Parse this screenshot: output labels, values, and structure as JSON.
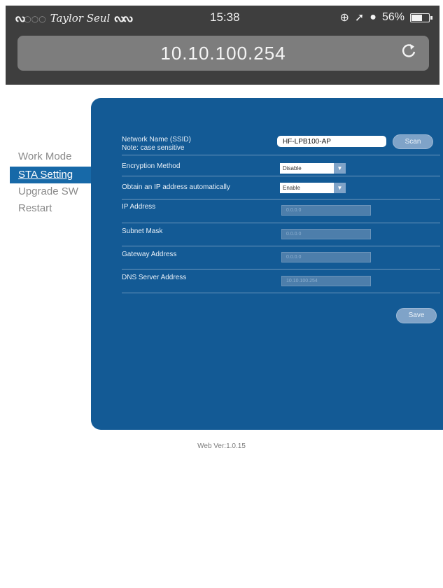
{
  "status_bar": {
    "carrier": "Taylor Seul",
    "time": "15:38",
    "battery_percent_label": "56%",
    "battery_level": 0.56,
    "icons": [
      "wifi-icon",
      "orientation-lock-icon",
      "location-arrow-icon",
      "alarm-icon",
      "battery-icon"
    ]
  },
  "browser": {
    "url": "10.10.100.254",
    "reload_glyph": "C"
  },
  "menu": {
    "items": [
      {
        "label": "Work Mode",
        "active": false
      },
      {
        "label": "STA Setting",
        "active": true
      },
      {
        "label": "Upgrade SW",
        "active": false
      },
      {
        "label": "Restart",
        "active": false
      }
    ]
  },
  "form": {
    "ssid": {
      "label_line1": "Network Name (SSID)",
      "label_line2": "Note: case sensitive",
      "value": "HF-LPB100-AP",
      "scan_label": "Scan"
    },
    "encryption": {
      "label": "Encryption Method",
      "value": "Disable"
    },
    "dhcp": {
      "label": "Obtain an IP address automatically",
      "value": "Enable"
    },
    "ip": {
      "label": "IP Address",
      "value": "0.0.0.0"
    },
    "subnet": {
      "label": "Subnet Mask",
      "value": "0.0.0.0"
    },
    "gateway": {
      "label": "Gateway Address",
      "value": "0.0.0.0"
    },
    "dns": {
      "label": "DNS Server Address",
      "value": "10.10.100.254"
    },
    "save_label": "Save"
  },
  "footer": {
    "version": "Web Ver:1.0.15"
  },
  "colors": {
    "panel": "#135a95",
    "active_menu": "#1769a8",
    "button": "#7fa3c8",
    "chrome": "#3e3e3e"
  }
}
